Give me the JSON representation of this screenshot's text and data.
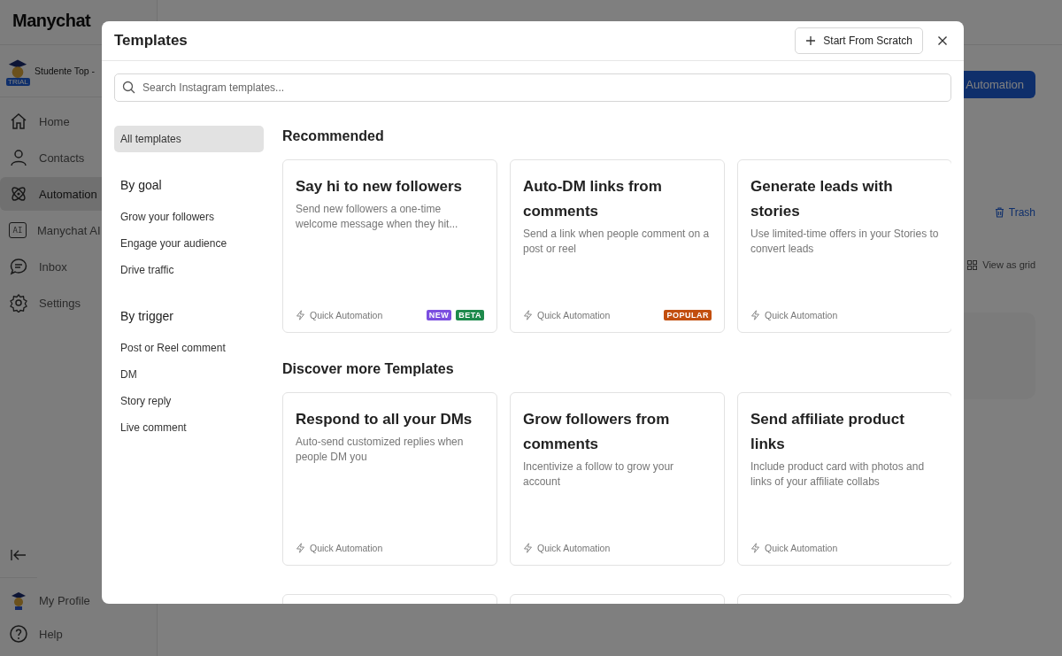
{
  "app": {
    "logo": "Manychat",
    "account": {
      "name": "Studente Top -",
      "badge": "TRIAL"
    },
    "nav": [
      {
        "label": "Home",
        "selected": false
      },
      {
        "label": "Contacts",
        "selected": false
      },
      {
        "label": "Automation",
        "selected": true
      },
      {
        "label": "Manychat AI",
        "icon_text": "AI",
        "selected": false
      },
      {
        "label": "Inbox",
        "selected": false
      },
      {
        "label": "Settings",
        "selected": false
      }
    ],
    "footer": [
      {
        "label": "My Profile"
      },
      {
        "label": "Help"
      }
    ],
    "main": {
      "primary_button": "Automation",
      "trash_link": "Trash",
      "view_toggle": "View as grid"
    }
  },
  "modal": {
    "title": "Templates",
    "start_button": "Start From Scratch",
    "search": {
      "placeholder": "Search Instagram templates..."
    },
    "filters": [
      {
        "kind": "item",
        "label": "All templates",
        "selected": true
      },
      {
        "kind": "heading",
        "label": "By goal"
      },
      {
        "kind": "item",
        "label": "Grow your followers",
        "selected": false
      },
      {
        "kind": "item",
        "label": "Engage your audience",
        "selected": false
      },
      {
        "kind": "item",
        "label": "Drive traffic",
        "selected": false
      },
      {
        "kind": "heading",
        "label": "By trigger"
      },
      {
        "kind": "item",
        "label": "Post or Reel comment",
        "selected": false
      },
      {
        "kind": "item",
        "label": "DM",
        "selected": false
      },
      {
        "kind": "item",
        "label": "Story reply",
        "selected": false
      },
      {
        "kind": "item",
        "label": "Live comment",
        "selected": false
      }
    ],
    "sections": [
      {
        "title": "Recommended",
        "cards": [
          {
            "title": "Say hi to new followers",
            "description": "Send new followers a one-time welcome message when they hit...",
            "type": "Quick Automation",
            "badges": [
              {
                "label": "NEW",
                "color": "#7b4ee0"
              },
              {
                "label": "BETA",
                "color": "#1e8a4c"
              }
            ]
          },
          {
            "title": "Auto-DM links from comments",
            "description": "Send a link when people comment on a post or reel",
            "type": "Quick Automation",
            "badges": [
              {
                "label": "POPULAR",
                "color": "#c24e0e"
              }
            ]
          },
          {
            "title": "Generate leads with stories",
            "description": "Use limited-time offers in your Stories to convert leads",
            "type": "Quick Automation"
          }
        ]
      },
      {
        "title": "Discover more Templates",
        "cards": [
          {
            "title": "Respond to all your DMs",
            "description": "Auto-send customized replies when people DM you",
            "type": "Quick Automation"
          },
          {
            "title": "Grow followers from comments",
            "description": "Incentivize a follow to grow your account",
            "type": "Quick Automation"
          },
          {
            "title": "Send affiliate product links",
            "description": "Include product card with photos and links of your affiliate collabs",
            "type": "Quick Automation"
          }
        ]
      }
    ]
  }
}
